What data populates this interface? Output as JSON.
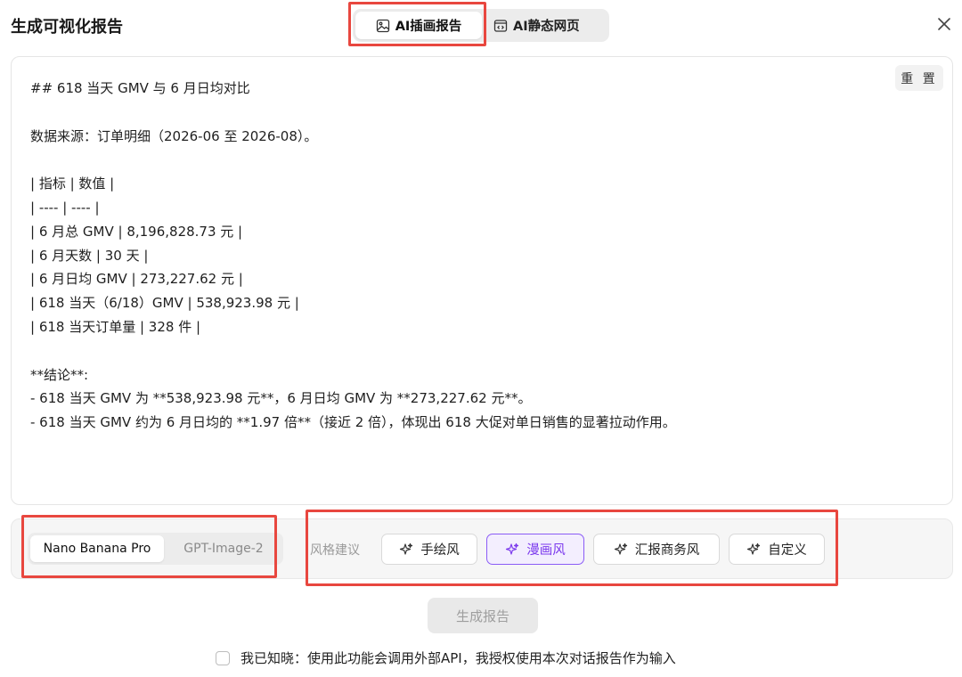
{
  "dialog": {
    "title": "生成可视化报告"
  },
  "tabs": [
    {
      "label": "AI插画报告",
      "icon": "image-icon",
      "active": true
    },
    {
      "label": "AI静态网页",
      "icon": "code-window-icon",
      "active": false
    }
  ],
  "editor": {
    "reset_label": "重 置",
    "lines": [
      "## 618 当天 GMV 与 6 月日均对比",
      "",
      "数据来源：订单明细（2026-06 至 2026-08）。",
      "",
      "| 指标 | 数值 |",
      "| ---- | ---- |",
      "| 6 月总 GMV | 8,196,828.73 元 |",
      "| 6 月天数 | 30 天 |",
      "| 6 月日均 GMV | 273,227.62 元 |",
      "| 618 当天（6/18）GMV | 538,923.98 元 |",
      "| 618 当天订单量 | 328 件 |",
      "",
      "**结论**:",
      "- 618 当天 GMV 为 **538,923.98 元**，6 月日均 GMV 为 **273,227.62 元**。",
      "- 618 当天 GMV 约为 6 月日均的 **1.97 倍**（接近 2 倍），体现出 618 大促对单日销售的显著拉动作用。"
    ]
  },
  "models": [
    {
      "label": "Nano Banana Pro",
      "active": true
    },
    {
      "label": "GPT-Image-2",
      "active": false
    }
  ],
  "style": {
    "label": "风格建议",
    "options": [
      {
        "label": "手绘风",
        "icon": "sparkle-icon",
        "selected": false
      },
      {
        "label": "漫画风",
        "icon": "sparkle-icon",
        "selected": true
      },
      {
        "label": "汇报商务风",
        "icon": "sparkle-icon",
        "selected": false
      },
      {
        "label": "自定义",
        "icon": "sparkle-icon",
        "selected": false
      }
    ]
  },
  "generate_label": "生成报告",
  "consent_text": "我已知晓：使用此功能会调用外部API，我授权使用本次对话报告作为输入",
  "colors": {
    "accent_purple": "#7c3aed",
    "highlight_red": "#e8473f"
  }
}
